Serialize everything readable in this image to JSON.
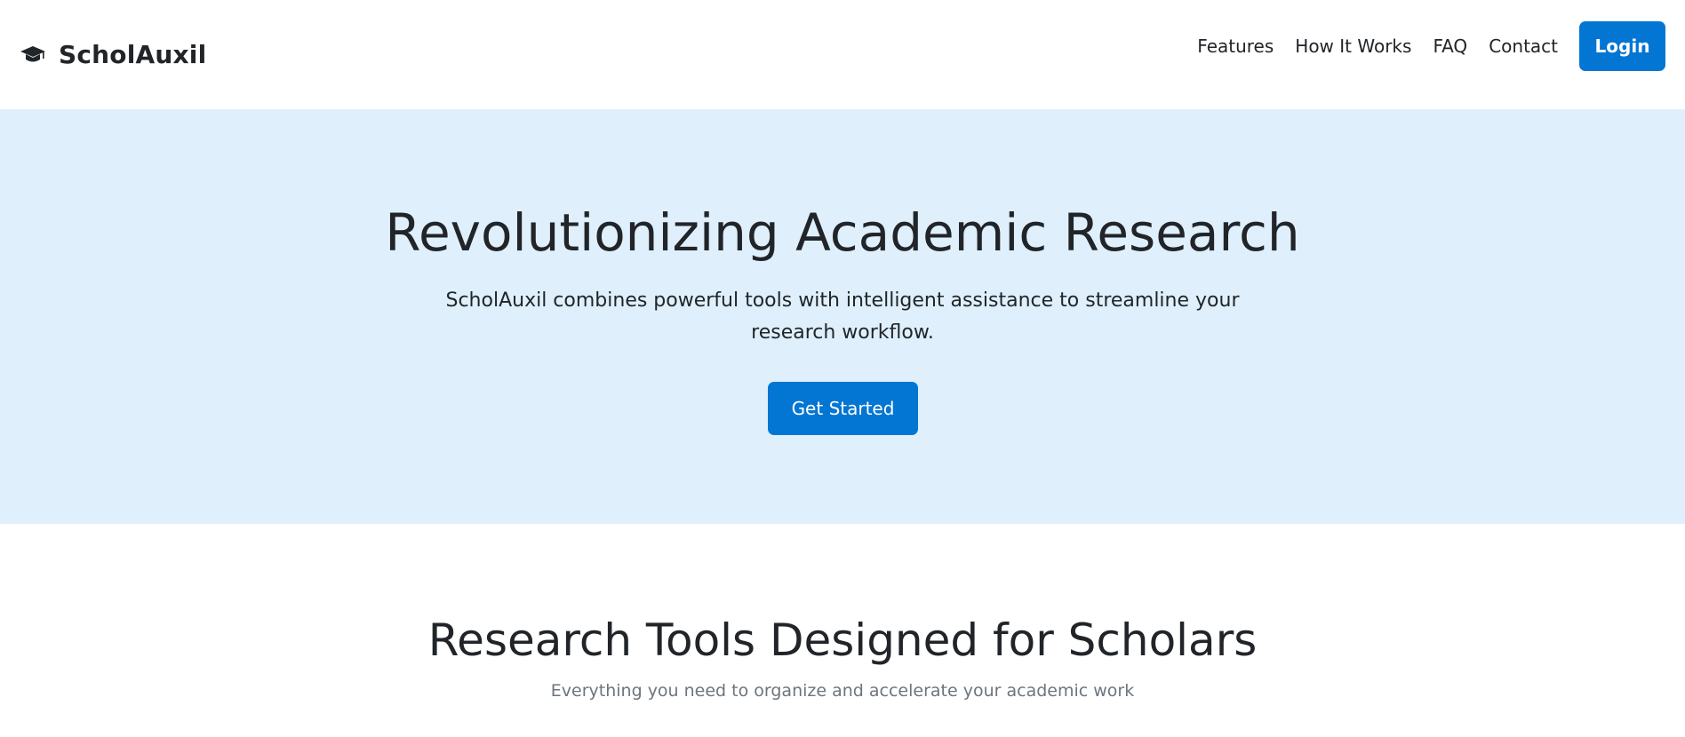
{
  "header": {
    "brand_name": "ScholAuxil",
    "brand_icon": "graduation-cap-icon",
    "nav": [
      {
        "label": "Features"
      },
      {
        "label": "How It Works"
      },
      {
        "label": "FAQ"
      },
      {
        "label": "Contact"
      }
    ],
    "login_label": "Login"
  },
  "hero": {
    "title": "Revolutionizing Academic Research",
    "subtitle": "ScholAuxil combines powerful tools with intelligent assistance to streamline your research workflow.",
    "cta_label": "Get Started"
  },
  "features": {
    "title": "Research Tools Designed for Scholars",
    "subtitle": "Everything you need to organize and accelerate your academic work"
  },
  "colors": {
    "primary": "#0376d3",
    "hero_background": "#dff0fc",
    "text": "#212529",
    "muted_text": "#6c757d"
  }
}
